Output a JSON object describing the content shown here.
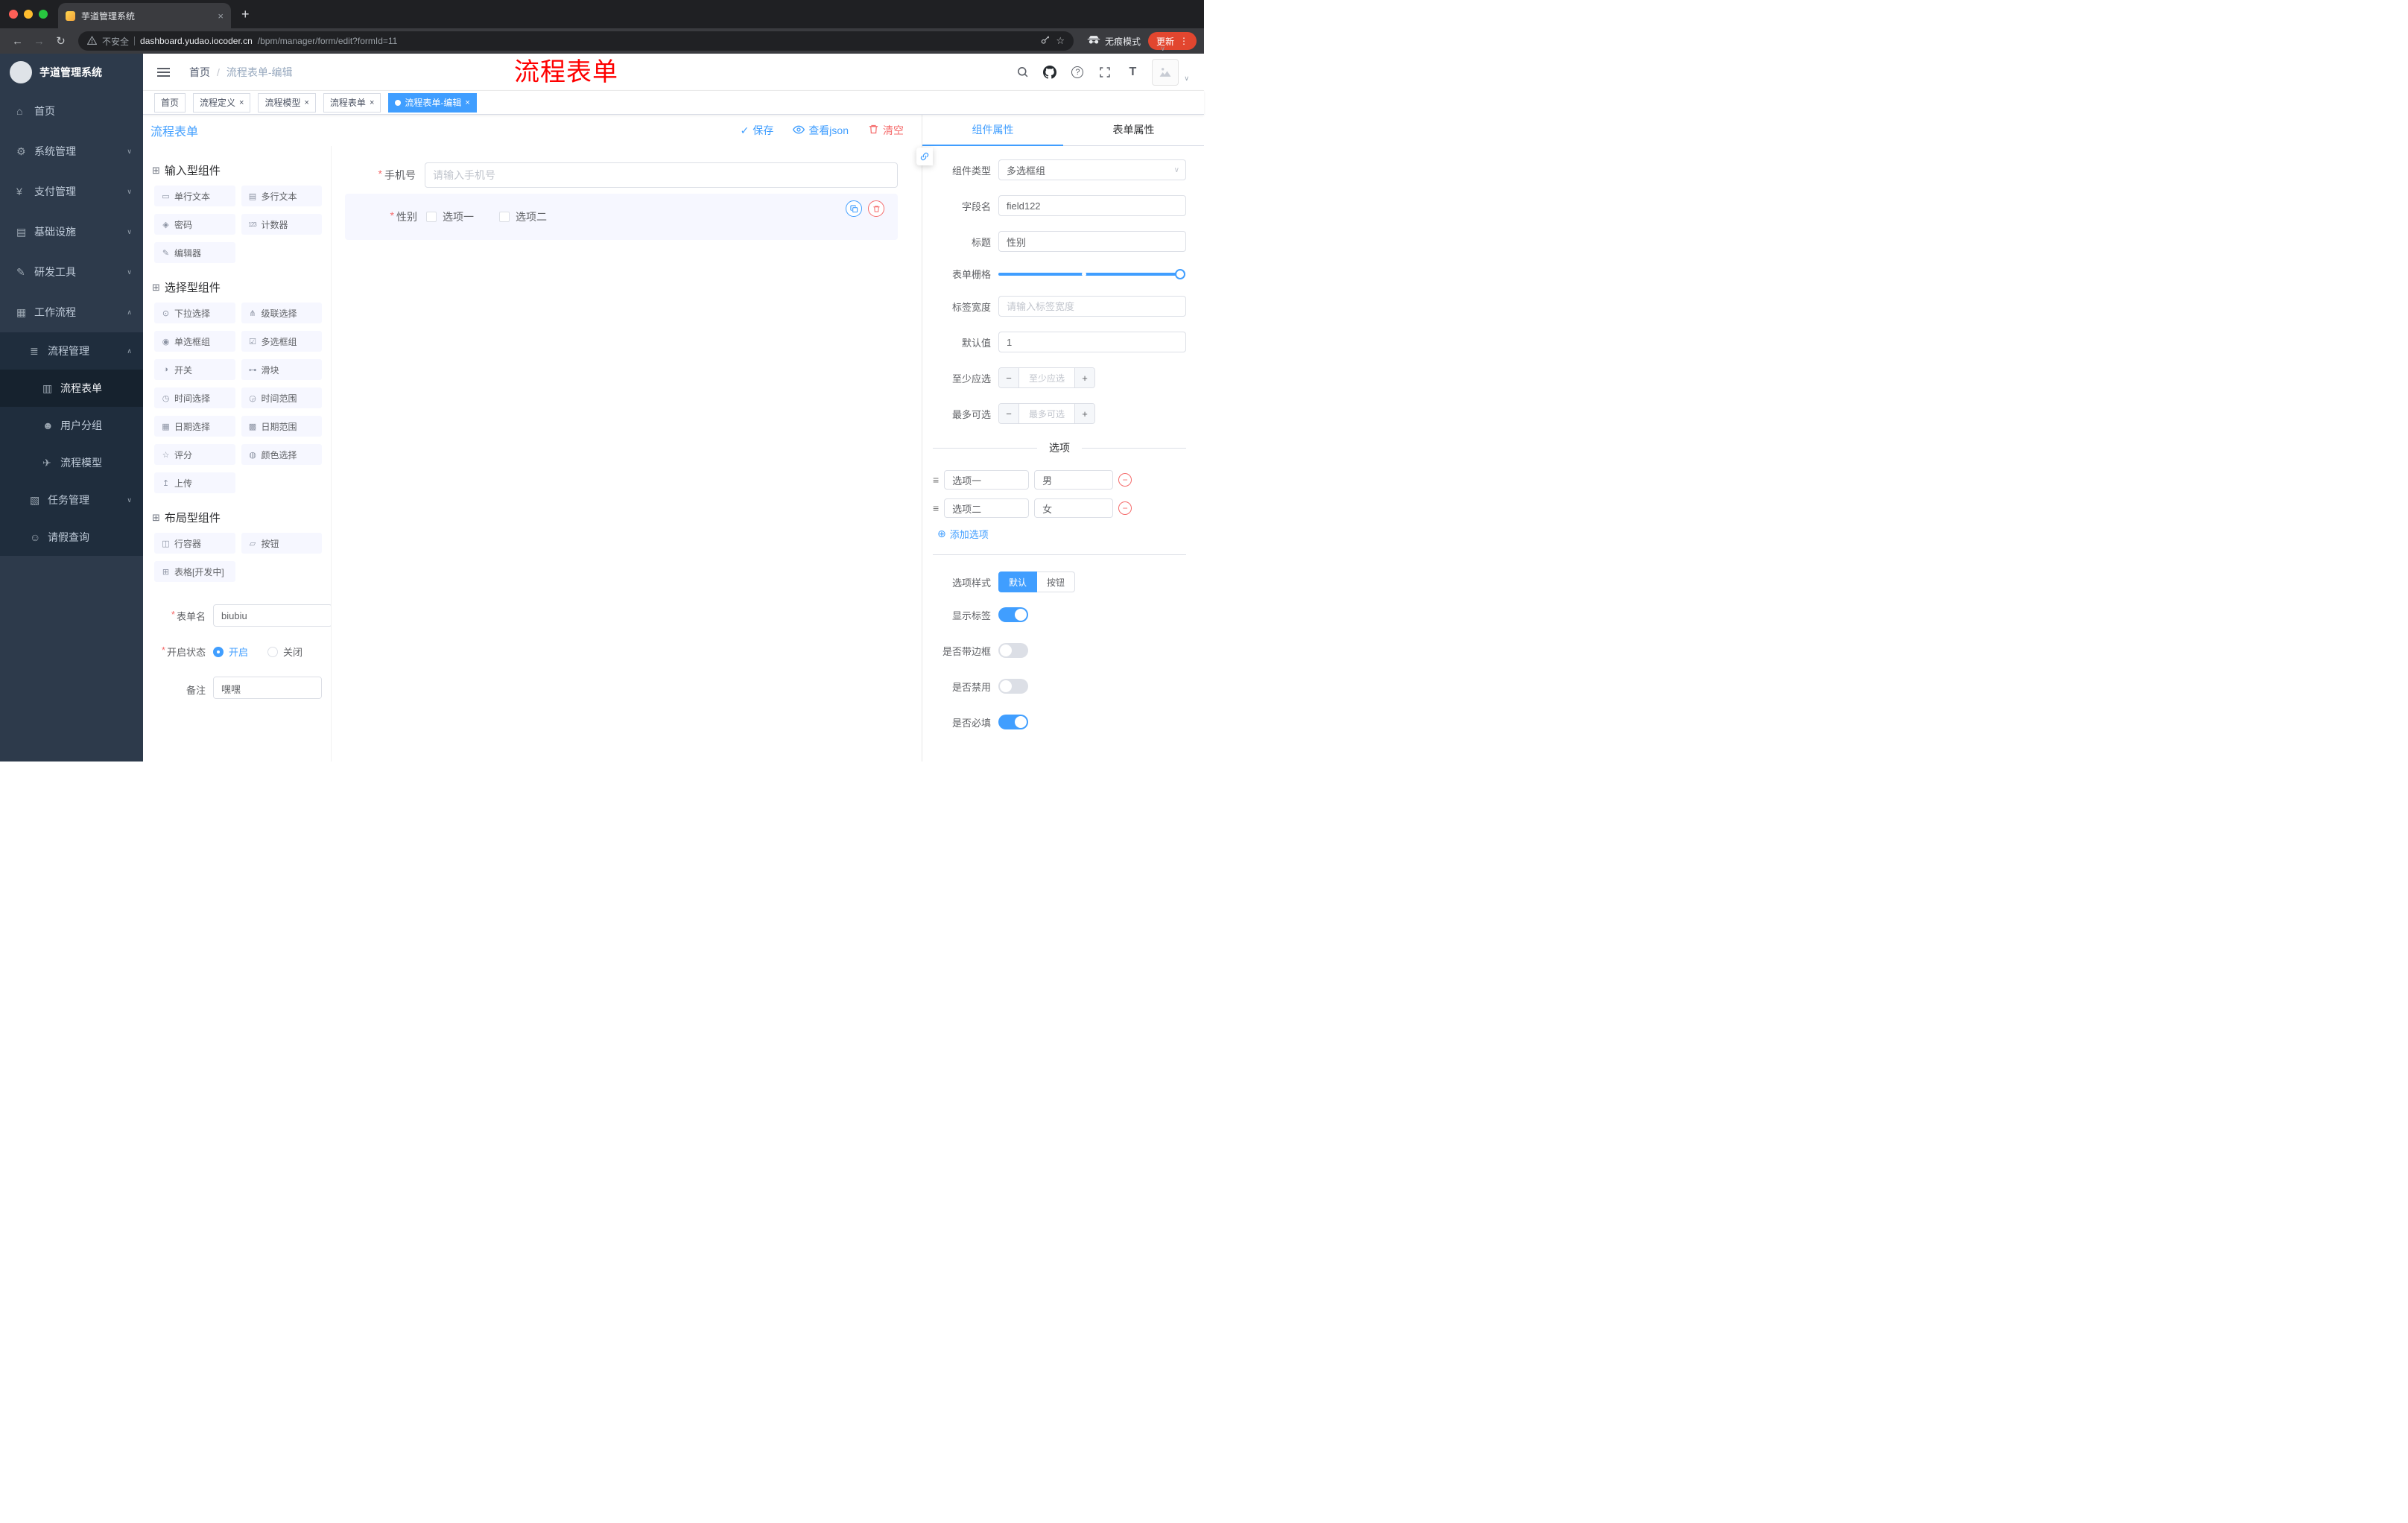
{
  "icons": {
    "close": "×",
    "plus": "+",
    "back": "←",
    "forward": "→",
    "reload": "↻",
    "dots": "⋮",
    "caret_down": "∨",
    "caret_up": "∧",
    "star": "☆",
    "question": "?",
    "font_size": "T",
    "check": "✓",
    "minus": "−",
    "plus_small": "+",
    "add_circle": "⊕",
    "drag_handle": "≡",
    "slash": "/"
  },
  "browser": {
    "tab_title": "芋道管理系统",
    "security_label": "不安全",
    "url_host": "dashboard.yudao.iocoder.cn",
    "url_path": "/bpm/manager/form/edit?formId=11",
    "incognito_label": "无痕模式",
    "update_label": "更新"
  },
  "sidebar": {
    "logo_title": "芋道管理系统",
    "items": [
      {
        "icon": "⌂",
        "label": "首页",
        "chevron": ""
      },
      {
        "icon": "⚙",
        "label": "系统管理",
        "chevron": "∨"
      },
      {
        "icon": "¥",
        "label": "支付管理",
        "chevron": "∨"
      },
      {
        "icon": "▤",
        "label": "基础设施",
        "chevron": "∨"
      },
      {
        "icon": "✎",
        "label": "研发工具",
        "chevron": "∨"
      },
      {
        "icon": "▦",
        "label": "工作流程",
        "chevron": "∧"
      },
      {
        "icon": "≣",
        "label": "流程管理",
        "chevron": "∧"
      },
      {
        "icon": "▥",
        "label": "流程表单",
        "chevron": ""
      },
      {
        "icon": "☻",
        "label": "用户分组",
        "chevron": ""
      },
      {
        "icon": "✈",
        "label": "流程模型",
        "chevron": ""
      },
      {
        "icon": "▧",
        "label": "任务管理",
        "chevron": "∨"
      },
      {
        "icon": "☺",
        "label": "请假查询",
        "chevron": ""
      }
    ]
  },
  "navbar": {
    "breadcrumb_root": "首页",
    "breadcrumb_current": "流程表单-编辑",
    "annotation": "流程表单"
  },
  "tags": [
    {
      "label": "首页"
    },
    {
      "label": "流程定义"
    },
    {
      "label": "流程模型"
    },
    {
      "label": "流程表单"
    },
    {
      "label": "流程表单-编辑"
    }
  ],
  "designer": {
    "title": "流程表单",
    "actions": {
      "save": "保存",
      "view_json": "查看json",
      "clear": "清空"
    },
    "groups": [
      {
        "icon": "⊞",
        "title": "输入型组件",
        "items": [
          {
            "icon": "▭",
            "label": "单行文本"
          },
          {
            "icon": "▤",
            "label": "多行文本"
          },
          {
            "icon": "◈",
            "label": "密码"
          },
          {
            "icon": "123",
            "label": "计数器"
          },
          {
            "icon": "✎",
            "label": "编辑器"
          }
        ]
      },
      {
        "icon": "⊞",
        "title": "选择型组件",
        "items": [
          {
            "icon": "⊙",
            "label": "下拉选择"
          },
          {
            "icon": "⋔",
            "label": "级联选择"
          },
          {
            "icon": "◉",
            "label": "单选框组"
          },
          {
            "icon": "☑",
            "label": "多选框组"
          },
          {
            "icon": "◑",
            "label": "开关"
          },
          {
            "icon": "⊶",
            "label": "滑块"
          },
          {
            "icon": "◷",
            "label": "时间选择"
          },
          {
            "icon": "◶",
            "label": "时间范围"
          },
          {
            "icon": "▦",
            "label": "日期选择"
          },
          {
            "icon": "▩",
            "label": "日期范围"
          },
          {
            "icon": "☆",
            "label": "评分"
          },
          {
            "icon": "◍",
            "label": "颜色选择"
          },
          {
            "icon": "↥",
            "label": "上传"
          }
        ]
      },
      {
        "icon": "⊞",
        "title": "布局型组件",
        "items": [
          {
            "icon": "◫",
            "label": "行容器"
          },
          {
            "icon": "▱",
            "label": "按钮"
          },
          {
            "icon": "⊞",
            "label": "表格[开发中]"
          }
        ]
      }
    ],
    "meta": {
      "name_label": "表单名",
      "name_value": "biubiu",
      "status_label": "开启状态",
      "status_on": "开启",
      "status_off": "关闭",
      "remark_label": "备注",
      "remark_value": "嘿嘿"
    },
    "canvas": {
      "phone_label": "手机号",
      "phone_placeholder": "请输入手机号",
      "gender_label": "性别",
      "gender_option1": "选项一",
      "gender_option2": "选项二"
    }
  },
  "props": {
    "tab_component": "组件属性",
    "tab_form": "表单属性",
    "rows": {
      "type_label": "组件类型",
      "type_value": "多选框组",
      "field_label": "字段名",
      "field_value": "field122",
      "title_label": "标题",
      "title_value": "性别",
      "grid_label": "表单栅格",
      "label_width_label": "标签宽度",
      "label_width_placeholder": "请输入标签宽度",
      "default_label": "默认值",
      "default_value": "1",
      "min_label": "至少应选",
      "min_placeholder": "至少应选",
      "max_label": "最多可选",
      "max_placeholder": "最多可选"
    },
    "options_title": "选项",
    "options": [
      {
        "name": "选项一",
        "value": "男"
      },
      {
        "name": "选项二",
        "value": "女"
      }
    ],
    "add_option": "添加选项",
    "style_label": "选项样式",
    "style_default": "默认",
    "style_button": "按钮",
    "switches": [
      {
        "label": "显示标签",
        "on": true
      },
      {
        "label": "是否带边框",
        "on": false
      },
      {
        "label": "是否禁用",
        "on": false
      },
      {
        "label": "是否必填",
        "on": true
      }
    ]
  },
  "colors": {
    "accent": "#409eff",
    "danger": "#f56c6c",
    "sidebar_bg": "#2d3a4b",
    "sidebar_sub_bg": "#1f2d3d",
    "update_pill": "#e2462f"
  }
}
